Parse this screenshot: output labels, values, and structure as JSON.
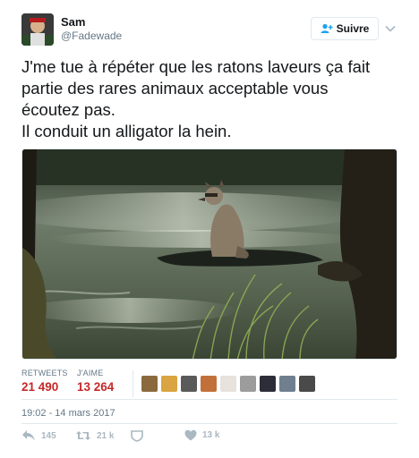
{
  "tweet": {
    "author": {
      "display_name": "Sam",
      "handle": "@Fadewade",
      "avatar_icon": "avatar-photo"
    },
    "follow_label": "Suivre",
    "follow_icon": "add-user-icon",
    "text": "J'me tue à répéter que les ratons laveurs ça fait\npartie des rares animaux acceptable vous\nécoutez pas.\nIl conduit un alligator la hein.",
    "media": {
      "description_icon": "photo-raccoon-on-alligator"
    },
    "stats": {
      "retweets_label": "RETWEETS",
      "retweets_value": "21 490",
      "likes_label": "J'AIME",
      "likes_value": "13 264"
    },
    "likers_count_shown": 9,
    "timestamp": "19:02 - 14 mars 2017",
    "actions": {
      "reply_count": "145",
      "retweet_count": "21 k",
      "like_count": "13 k"
    },
    "colors": {
      "stat_value": "#c62828",
      "muted": "#657786",
      "icon_muted": "#aab8c2",
      "border": "#e1e8ed",
      "accent": "#1da1f2"
    }
  }
}
